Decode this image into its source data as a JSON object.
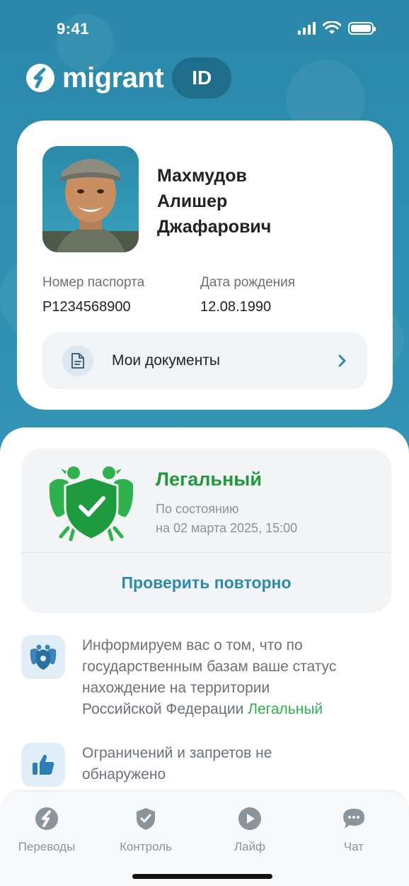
{
  "status_bar": {
    "time": "9:41"
  },
  "header": {
    "brand_name": "migrant",
    "badge": "ID"
  },
  "profile": {
    "last_name": "Махмудов",
    "first_name": "Алишер",
    "patronymic": "Джафарович",
    "passport_label": "Номер паспорта",
    "passport_value": "P1234568900",
    "birth_label": "Дата рождения",
    "birth_value": "12.08.1990",
    "documents_label": "Мои документы"
  },
  "status": {
    "title": "Легальный",
    "sub_line1": "По состоянию",
    "sub_line2": "на 02 марта 2025, 15:00",
    "recheck_label": "Проверить повторно",
    "color": "#1f9a3b"
  },
  "info": {
    "legal_text_line1": "Информируем вас о том, что по",
    "legal_text_line2": "государственным базам ваше статус",
    "legal_text_line3": "нахождение на территории",
    "legal_text_line4_prefix": "Российской Федерации",
    "legal_text_highlight": "Легальный",
    "restrictions_line1": "Ограничений и запретов не",
    "restrictions_line2": "обнаружено"
  },
  "tabs": [
    {
      "label": "Переводы",
      "icon": "transfer-icon"
    },
    {
      "label": "Контроль",
      "icon": "shield-check-icon"
    },
    {
      "label": "Лайф",
      "icon": "play-icon"
    },
    {
      "label": "Чат",
      "icon": "chat-icon"
    }
  ],
  "colors": {
    "brand": "#2f8fb0",
    "accent_link": "#2d8aab",
    "legal_green": "#2fb14d"
  }
}
